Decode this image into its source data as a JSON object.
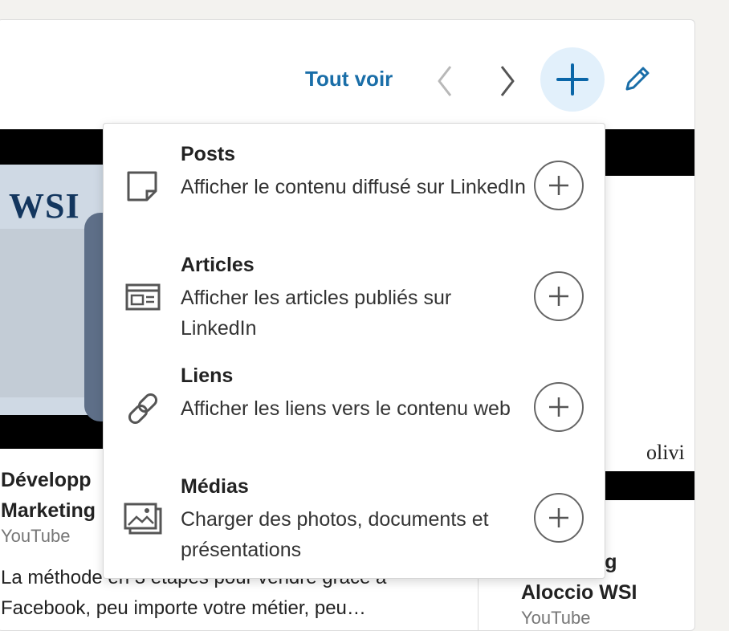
{
  "header": {
    "see_all_label": "Tout voir",
    "prev_icon": "chevron-left-icon",
    "next_icon": "chevron-right-icon",
    "add_icon": "plus-icon",
    "edit_icon": "pencil-icon",
    "accent_color": "#1a6ea8"
  },
  "carousel": {
    "cards": [
      {
        "image_text": "WSI",
        "title": "Développ\nMarketing",
        "source": "YouTube",
        "description": "La méthode en 3 étapes pour vendre grâce à Facebook, peu importe votre métier, peu…"
      },
      {
        "image_text": "olivi",
        "title": "marketing\nAloccio WSI",
        "source": "YouTube"
      }
    ]
  },
  "menu": {
    "items": [
      {
        "icon": "post-note-icon",
        "title": "Posts",
        "description": "Afficher le contenu diffusé sur LinkedIn"
      },
      {
        "icon": "article-icon",
        "title": "Articles",
        "description": "Afficher les articles publiés sur LinkedIn"
      },
      {
        "icon": "link-icon",
        "title": "Liens",
        "description": "Afficher les liens vers le contenu web"
      },
      {
        "icon": "media-images-icon",
        "title": "Médias",
        "description": "Charger des photos, documents et présentations"
      }
    ]
  }
}
